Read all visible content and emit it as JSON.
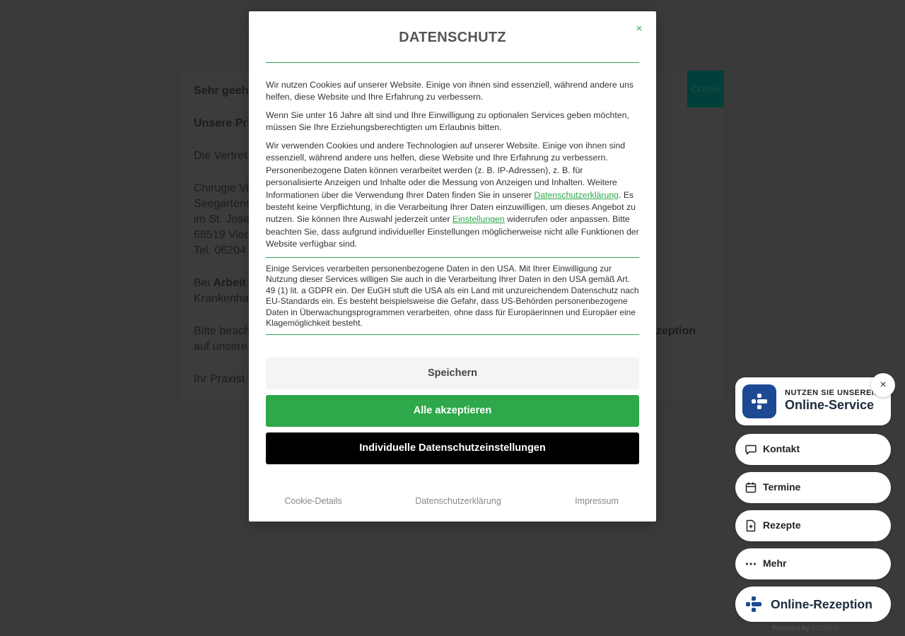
{
  "background": {
    "lines": [
      {
        "text": "Sehr geeh",
        "bold": true
      },
      {
        "text": "Unsere Pr",
        "bold": true
      },
      {
        "text": "Die Vertret",
        "bold": false
      },
      {
        "text": "Chirugie Vi",
        "bold": false
      },
      {
        "text": "Seegartens",
        "bold": false
      },
      {
        "text": "im St. Jose",
        "bold": false
      },
      {
        "text": "68519 Vier",
        "bold": false
      },
      {
        "text": "Tel. 06204",
        "bold": false
      },
      {
        "text_prefix": "Bei ",
        "text_bold": "Arbeit"
      },
      {
        "text": "Krankenha",
        "bold": false
      },
      {
        "text": "Bitte beach",
        "bold": false
      },
      {
        "text": "auf unsere",
        "bold": false
      },
      {
        "text": "Ihr Praxist",
        "bold": false
      }
    ],
    "right_fragment": "zeption",
    "close_label": "CLOSE"
  },
  "modal": {
    "title": "DATENSCHUTZ",
    "close_symbol": "×",
    "p1": "Wir nutzen Cookies auf unserer Website. Einige von ihnen sind essenziell, während andere uns helfen, diese Website und Ihre Erfahrung zu verbessern.",
    "p2": "Wenn Sie unter 16 Jahre alt sind und Ihre Einwilligung zu optionalen Services geben möchten, müssen Sie Ihre Erziehungsberechtigten um Erlaubnis bitten.",
    "p3_a": "Wir verwenden Cookies und andere Technologien auf unserer Website. Einige von ihnen sind essenziell, während andere uns helfen, diese Website und Ihre Erfahrung zu verbessern. Personenbezogene Daten können verarbeitet werden (z. B. IP-Adressen), z. B. für personalisierte Anzeigen und Inhalte oder die Messung von Anzeigen und Inhalten. Weitere Informationen über die Verwendung Ihrer Daten finden Sie in unserer ",
    "p3_link1": "Datenschutzerklärung",
    "p3_b": ". Es besteht keine Verpflichtung, in die Verarbeitung Ihrer Daten einzuwilligen, um dieses Angebot zu nutzen. Sie können Ihre Auswahl jederzeit unter ",
    "p3_link2": "Einstellungen",
    "p3_c": " widerrufen oder anpassen. Bitte beachten Sie, dass aufgrund individueller Einstellungen möglicherweise nicht alle Funktionen der Website verfügbar sind.",
    "p4": "Einige Services verarbeiten personenbezogene Daten in den USA. Mit Ihrer Einwilligung zur Nutzung dieser Services willigen Sie auch in die Verarbeitung Ihrer Daten in den USA gemäß Art. 49 (1) lit. a GDPR ein. Der EuGH stuft die USA als ein Land mit unzureichendem Datenschutz nach EU-Standards ein. Es besteht beispielsweise die Gefahr, dass US-Behörden personenbezogene Daten in Überwachungsprogrammen verarbeiten, ohne dass für Europäerinnen und Europäer eine Klagemöglichkeit besteht.",
    "buttons": {
      "save": "Speichern",
      "accept_all": "Alle akzeptieren",
      "custom": "Individuelle Datenschutzeinstellungen"
    },
    "footer_links": {
      "cookie_details": "Cookie-Details",
      "privacy": "Datenschutzerklärung",
      "imprint": "Impressum"
    }
  },
  "widget": {
    "small_label": "NUTZEN SIE UNSEREN",
    "big_label": "Online-Service",
    "close_symbol": "×",
    "items": [
      {
        "label": "Kontakt",
        "icon": "chat-icon"
      },
      {
        "label": "Termine",
        "icon": "calendar-icon"
      },
      {
        "label": "Rezepte",
        "icon": "prescription-icon"
      },
      {
        "label": "Mehr",
        "icon": "more-icon"
      }
    ],
    "reception_label": "Online-Rezeption",
    "powered_prefix": "Powered by ",
    "powered_brand": "321MED",
    "brand_color": "#1c4a92",
    "accent_color": "#2ea84a"
  }
}
